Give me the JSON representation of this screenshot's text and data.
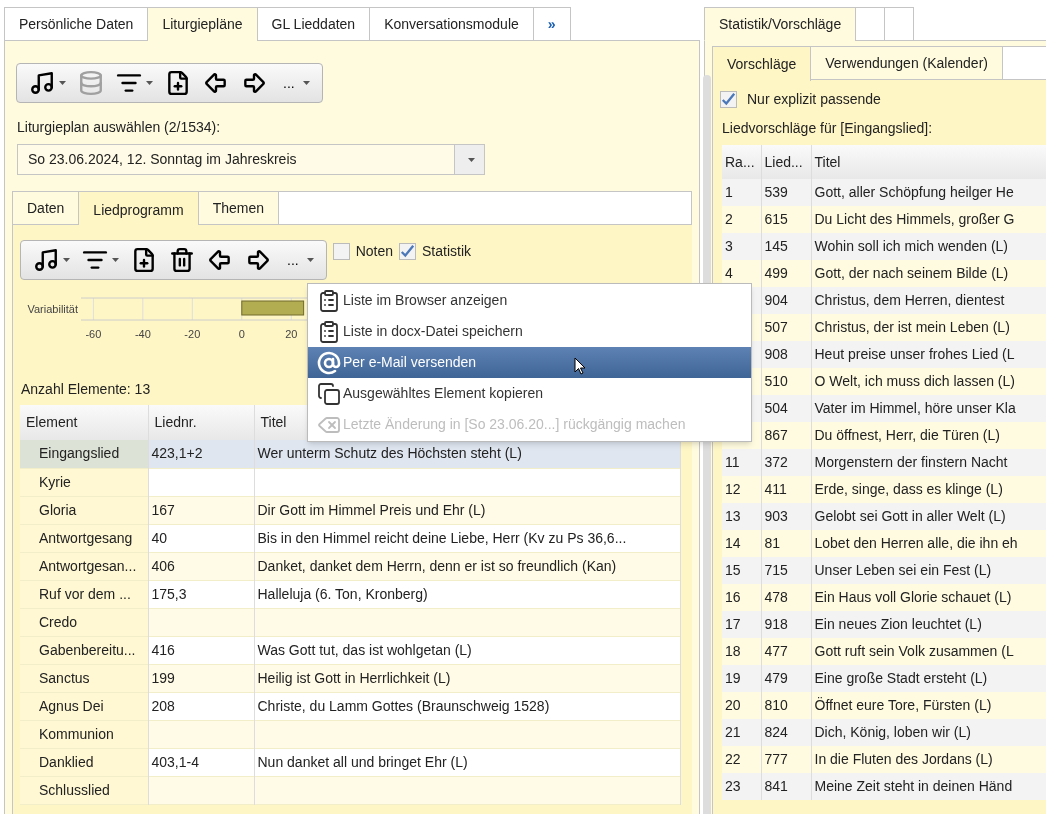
{
  "left_tabs": [
    {
      "label": "Persönliche Daten",
      "selected": false
    },
    {
      "label": "Liturgiepläne",
      "selected": true
    },
    {
      "label": "GL Lieddaten",
      "selected": false
    },
    {
      "label": "Konversationsmodule",
      "selected": false
    },
    {
      "label": "»",
      "selected": false
    }
  ],
  "toolbar": [
    {
      "kind": "music",
      "dropdown": true,
      "disabled": false
    },
    {
      "kind": "database",
      "dropdown": false,
      "disabled": true
    },
    {
      "kind": "filter",
      "dropdown": true,
      "disabled": false
    },
    {
      "kind": "add",
      "dropdown": false,
      "disabled": false
    },
    {
      "kind": "prev",
      "dropdown": false,
      "disabled": false
    },
    {
      "kind": "next",
      "dropdown": false,
      "disabled": false
    },
    {
      "kind": "more",
      "label": "...",
      "dropdown": true,
      "disabled": false
    }
  ],
  "plan_label": "Liturgieplan auswählen (2/1534):",
  "plan_select": {
    "value": "So 23.06.2024, 12. Sonntag im Jahreskreis"
  },
  "inner_tabs": [
    {
      "label": "Daten",
      "selected": false
    },
    {
      "label": "Liedprogramm",
      "selected": true
    },
    {
      "label": "Themen",
      "selected": false
    }
  ],
  "toolbar2": [
    {
      "kind": "music",
      "dropdown": true,
      "disabled": false
    },
    {
      "kind": "filter",
      "dropdown": true,
      "disabled": false
    },
    {
      "kind": "add",
      "dropdown": false,
      "disabled": false
    },
    {
      "kind": "delete",
      "dropdown": false,
      "disabled": false
    },
    {
      "kind": "prev",
      "dropdown": false,
      "disabled": false
    },
    {
      "kind": "next",
      "dropdown": false,
      "disabled": false
    },
    {
      "kind": "more",
      "label": "...",
      "dropdown": true,
      "disabled": false
    }
  ],
  "options": [
    {
      "label": "Noten",
      "checked": false
    },
    {
      "label": "Statistik",
      "checked": true
    }
  ],
  "chart_data": {
    "type": "bar",
    "orientation": "horizontal",
    "categories": [
      "Variabilität"
    ],
    "values": [
      25
    ],
    "xlim": [
      -65,
      30
    ],
    "xticks": [
      -60,
      -40,
      -20,
      0,
      20
    ]
  },
  "count_label": "Anzahl Elemente: 13",
  "program_table": {
    "columns": [
      "Element",
      "Liednr.",
      "Titel"
    ],
    "rows": [
      {
        "element": "Eingangslied",
        "number": "423,1+2",
        "title": "Wer unterm Schutz des Höchsten steht (L)",
        "selected": true
      },
      {
        "element": "Kyrie",
        "number": "",
        "title": "",
        "selected": false
      },
      {
        "element": "Gloria",
        "number": "167",
        "title": "Dir Gott im Himmel Preis und Ehr (L)",
        "selected": false
      },
      {
        "element": "Antwortgesang",
        "number": "40",
        "title": "Bis in den Himmel reicht deine Liebe, Herr (Kv zu Ps 36,6...",
        "selected": false
      },
      {
        "element": "Antwortgesan...",
        "number": "406",
        "title": "Danket, danket dem Herrn, denn er ist so freundlich (Kan)",
        "selected": false
      },
      {
        "element": "Ruf vor dem ...",
        "number": "175,3",
        "title": "Halleluja (6. Ton, Kronberg)",
        "selected": false
      },
      {
        "element": "Credo",
        "number": "",
        "title": "",
        "selected": false
      },
      {
        "element": "Gabenbereitu...",
        "number": "416",
        "title": "Was Gott tut, das ist wohlgetan (L)",
        "selected": false
      },
      {
        "element": "Sanctus",
        "number": "199",
        "title": "Heilig ist Gott in Herrlichkeit (L)",
        "selected": false
      },
      {
        "element": "Agnus Dei",
        "number": "208",
        "title": "Christe, du Lamm Gottes (Braunschweig 1528)",
        "selected": false
      },
      {
        "element": "Kommunion",
        "number": "",
        "title": "",
        "selected": false
      },
      {
        "element": "Danklied",
        "number": "403,1-4",
        "title": "Nun danket all und bringet Ehr (L)",
        "selected": false
      },
      {
        "element": "Schlusslied",
        "number": "",
        "title": "",
        "selected": false
      }
    ]
  },
  "context_menu": [
    {
      "kind": "clipboard",
      "label": "Liste im Browser anzeigen",
      "selected": false,
      "disabled": false
    },
    {
      "kind": "clipboard",
      "label": "Liste in docx-Datei speichern",
      "selected": false,
      "disabled": false
    },
    {
      "kind": "at",
      "label": "Per e-Mail versenden",
      "selected": true,
      "disabled": false
    },
    {
      "kind": "copy",
      "label": "Ausgewähltes Element kopieren",
      "selected": false,
      "disabled": false
    },
    {
      "kind": "undo",
      "label": "Letzte Änderung in [So 23.06.20...] rückgängig machen",
      "selected": false,
      "disabled": true
    }
  ],
  "right_tabs": [
    {
      "label": "Statistik/Vorschläge",
      "selected": true
    },
    {
      "selected": false
    },
    {
      "selected": false
    }
  ],
  "right_inner_tabs": [
    {
      "label": "Vorschläge",
      "selected": true
    },
    {
      "label": "Verwendungen (Kalender)",
      "selected": false
    }
  ],
  "explicit_filter": {
    "label": "Nur explizit passende",
    "checked": true
  },
  "suggestions_label": "Liedvorschläge für [Eingangslied]:",
  "suggestions_table": {
    "columns": [
      "Ra...",
      "Lied...",
      "Titel"
    ],
    "rows": [
      {
        "rank": "1",
        "number": "539",
        "title": "Gott, aller Schöpfung heilger He"
      },
      {
        "rank": "2",
        "number": "615",
        "title": "Du Licht des Himmels, großer G"
      },
      {
        "rank": "3",
        "number": "145",
        "title": "Wohin soll ich mich wenden (L)"
      },
      {
        "rank": "4",
        "number": "499",
        "title": "Gott, der nach seinem Bilde (L)"
      },
      {
        "number": "904",
        "title": "Christus, dem Herren, dientest"
      },
      {
        "number": "507",
        "title": "Christus, der ist mein Leben (L)"
      },
      {
        "number": "908",
        "title": "Heut preise unser frohes Lied (L"
      },
      {
        "number": "510",
        "title": "O Welt, ich muss dich lassen (L)"
      },
      {
        "number": "504",
        "title": "Vater im Himmel, höre unser Kla"
      },
      {
        "number": "867",
        "title": "Du öffnest, Herr, die Türen (L)"
      },
      {
        "rank": "11",
        "number": "372",
        "title": "Morgenstern der finstern Nacht"
      },
      {
        "rank": "12",
        "number": "411",
        "title": "Erde, singe, dass es klinge (L)"
      },
      {
        "rank": "13",
        "number": "903",
        "title": "Gelobt sei Gott in aller Welt (L)"
      },
      {
        "rank": "14",
        "number": "81",
        "title": "Lobet den Herren alle, die ihn eh"
      },
      {
        "rank": "15",
        "number": "715",
        "title": "Unser Leben sei ein Fest (L)"
      },
      {
        "rank": "16",
        "number": "478",
        "title": "Ein Haus voll Glorie schauet (L)"
      },
      {
        "rank": "17",
        "number": "918",
        "title": "Ein neues Zion leuchtet (L)"
      },
      {
        "rank": "18",
        "number": "477",
        "title": "Gott ruft sein Volk zusammen (L"
      },
      {
        "rank": "19",
        "number": "479",
        "title": "Eine große Stadt ersteht (L)"
      },
      {
        "rank": "20",
        "number": "810",
        "title": "Öffnet eure Tore, Fürsten (L)"
      },
      {
        "rank": "21",
        "number": "824",
        "title": "Dich, König, loben wir (L)"
      },
      {
        "rank": "22",
        "number": "777",
        "title": "In die Fluten des Jordans (L)"
      },
      {
        "rank": "23",
        "number": "841",
        "title": "Meine Zeit steht in deinen Händ"
      }
    ]
  }
}
